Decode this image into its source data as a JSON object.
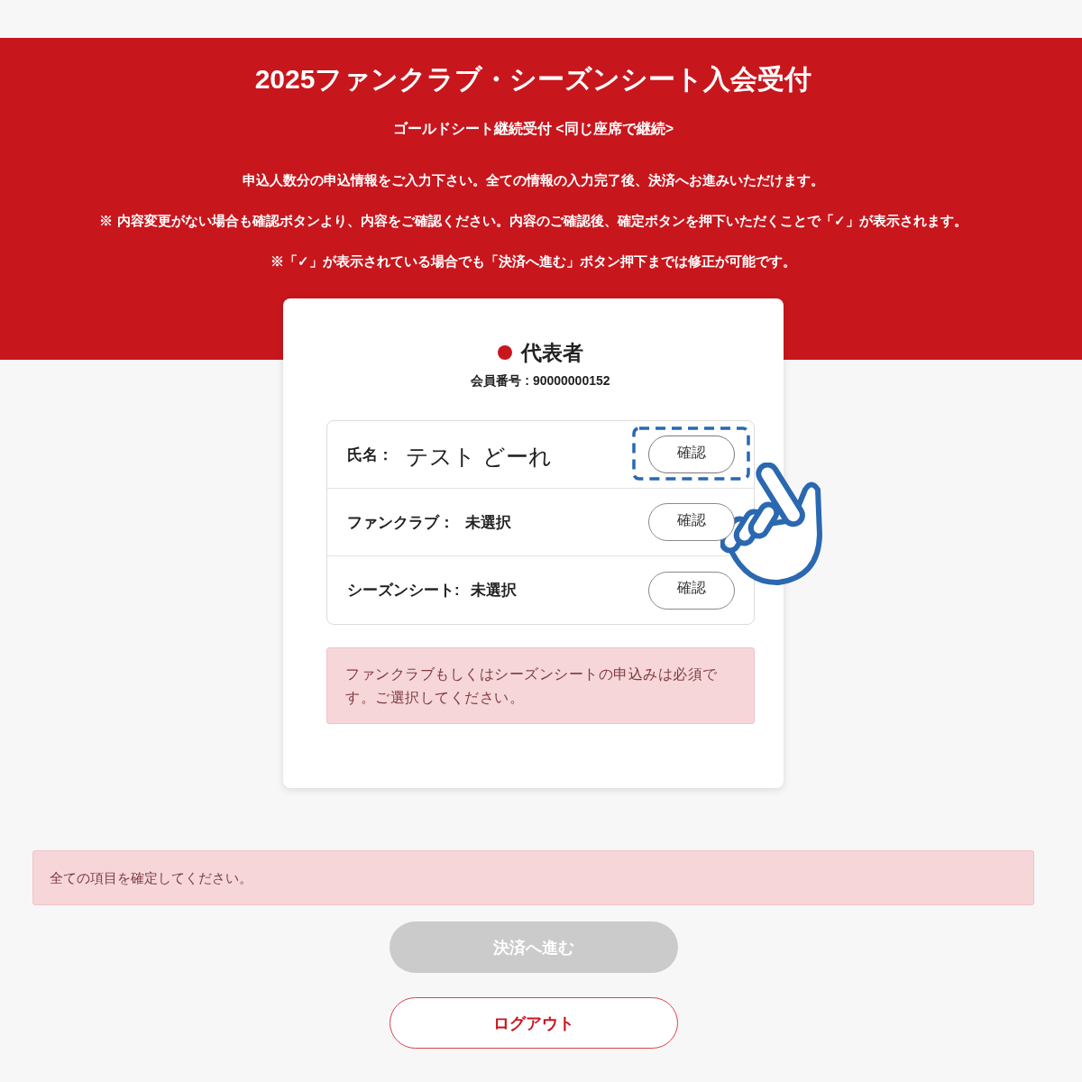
{
  "header": {
    "title": "2025ファンクラブ・シーズンシート入会受付",
    "subtitle": "ゴールドシート継続受付 <同じ座席で継続>",
    "notes": [
      "申込人数分の申込情報をご入力下さい。全ての情報の入力完了後、決済へお進みいただけます。",
      "※ 内容変更がない場合も確認ボタンより、内容をご確認ください。内容のご確認後、確定ボタンを押下いただくことで「✓」が表示されます。",
      "※「✓」が表示されている場合でも「決済へ進む」ボタン押下までは修正が可能です。"
    ]
  },
  "card": {
    "heading": "代表者",
    "member_number": "会員番号 : 90000000152",
    "fields": [
      {
        "kind": "name",
        "label": "氏名：",
        "value": "テスト どーれ",
        "button": "確認",
        "highlighted": true
      },
      {
        "kind": "selection",
        "label": "ファンクラブ：",
        "value": "未選択",
        "button": "確認",
        "highlighted": false
      },
      {
        "kind": "selection",
        "label": "シーズンシート:",
        "value": "未選択",
        "button": "確認",
        "highlighted": false
      }
    ],
    "alert": "ファンクラブもしくはシーズンシートの申込みは必須です。ご選択してください。"
  },
  "page_alert": "全ての項目を確定してください。",
  "buttons": [
    {
      "kind": "primary",
      "label": "決済へ進む",
      "disabled": true
    },
    {
      "kind": "outline",
      "label": "ログアウト",
      "disabled": false
    }
  ]
}
